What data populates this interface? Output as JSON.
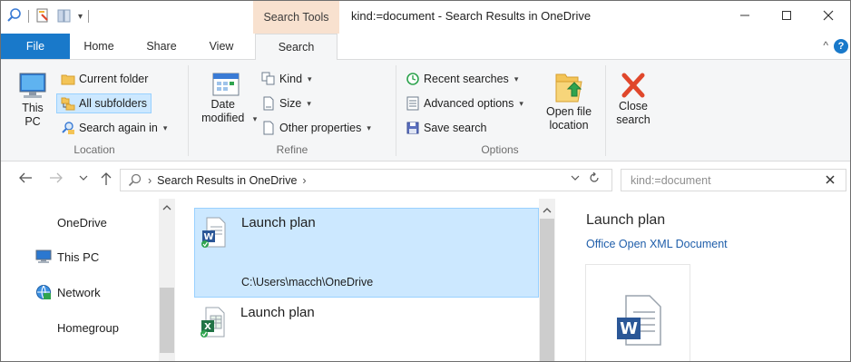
{
  "window": {
    "title": "kind:=document - Search Results in OneDrive",
    "context_tab": "Search Tools",
    "controls": {
      "minimize": "—",
      "maximize": "☐",
      "close": "✕"
    }
  },
  "tabs": {
    "file": "File",
    "home": "Home",
    "share": "Share",
    "view": "View",
    "search": "Search",
    "help": "?",
    "collapse": "^"
  },
  "ribbon": {
    "location": {
      "label": "Location",
      "this_pc": "This PC",
      "current_folder": "Current folder",
      "all_subfolders": "All subfolders",
      "search_again_in": "Search again in"
    },
    "refine": {
      "label": "Refine",
      "date_modified": "Date modified",
      "kind": "Kind",
      "size": "Size",
      "other_properties": "Other properties"
    },
    "options": {
      "label": "Options",
      "recent_searches": "Recent searches",
      "advanced_options": "Advanced options",
      "save_search": "Save search",
      "open_file_location": "Open file location"
    },
    "close_search": "Close search"
  },
  "addressbar": {
    "breadcrumb": "Search Results in OneDrive",
    "search_value": "kind:=document"
  },
  "navpane": {
    "items": [
      {
        "label": "OneDrive",
        "icon": "onedrive-icon"
      },
      {
        "label": "This PC",
        "icon": "computer-icon"
      },
      {
        "label": "Network",
        "icon": "network-icon"
      },
      {
        "label": "Homegroup",
        "icon": "homegroup-icon"
      }
    ]
  },
  "files": [
    {
      "name": "Launch plan",
      "path": "C:\\Users\\macch\\OneDrive",
      "type": "word",
      "selected": true
    },
    {
      "name": "Launch plan",
      "path": "",
      "type": "excel",
      "selected": false
    }
  ],
  "preview": {
    "title": "Launch plan",
    "type": "Office Open XML Document"
  },
  "colors": {
    "accent": "#1979ca",
    "selection": "#cce8ff",
    "selection_border": "#99d1ff",
    "context_tab": "#f8e1cf",
    "ribbon_bg": "#f5f6f7"
  }
}
